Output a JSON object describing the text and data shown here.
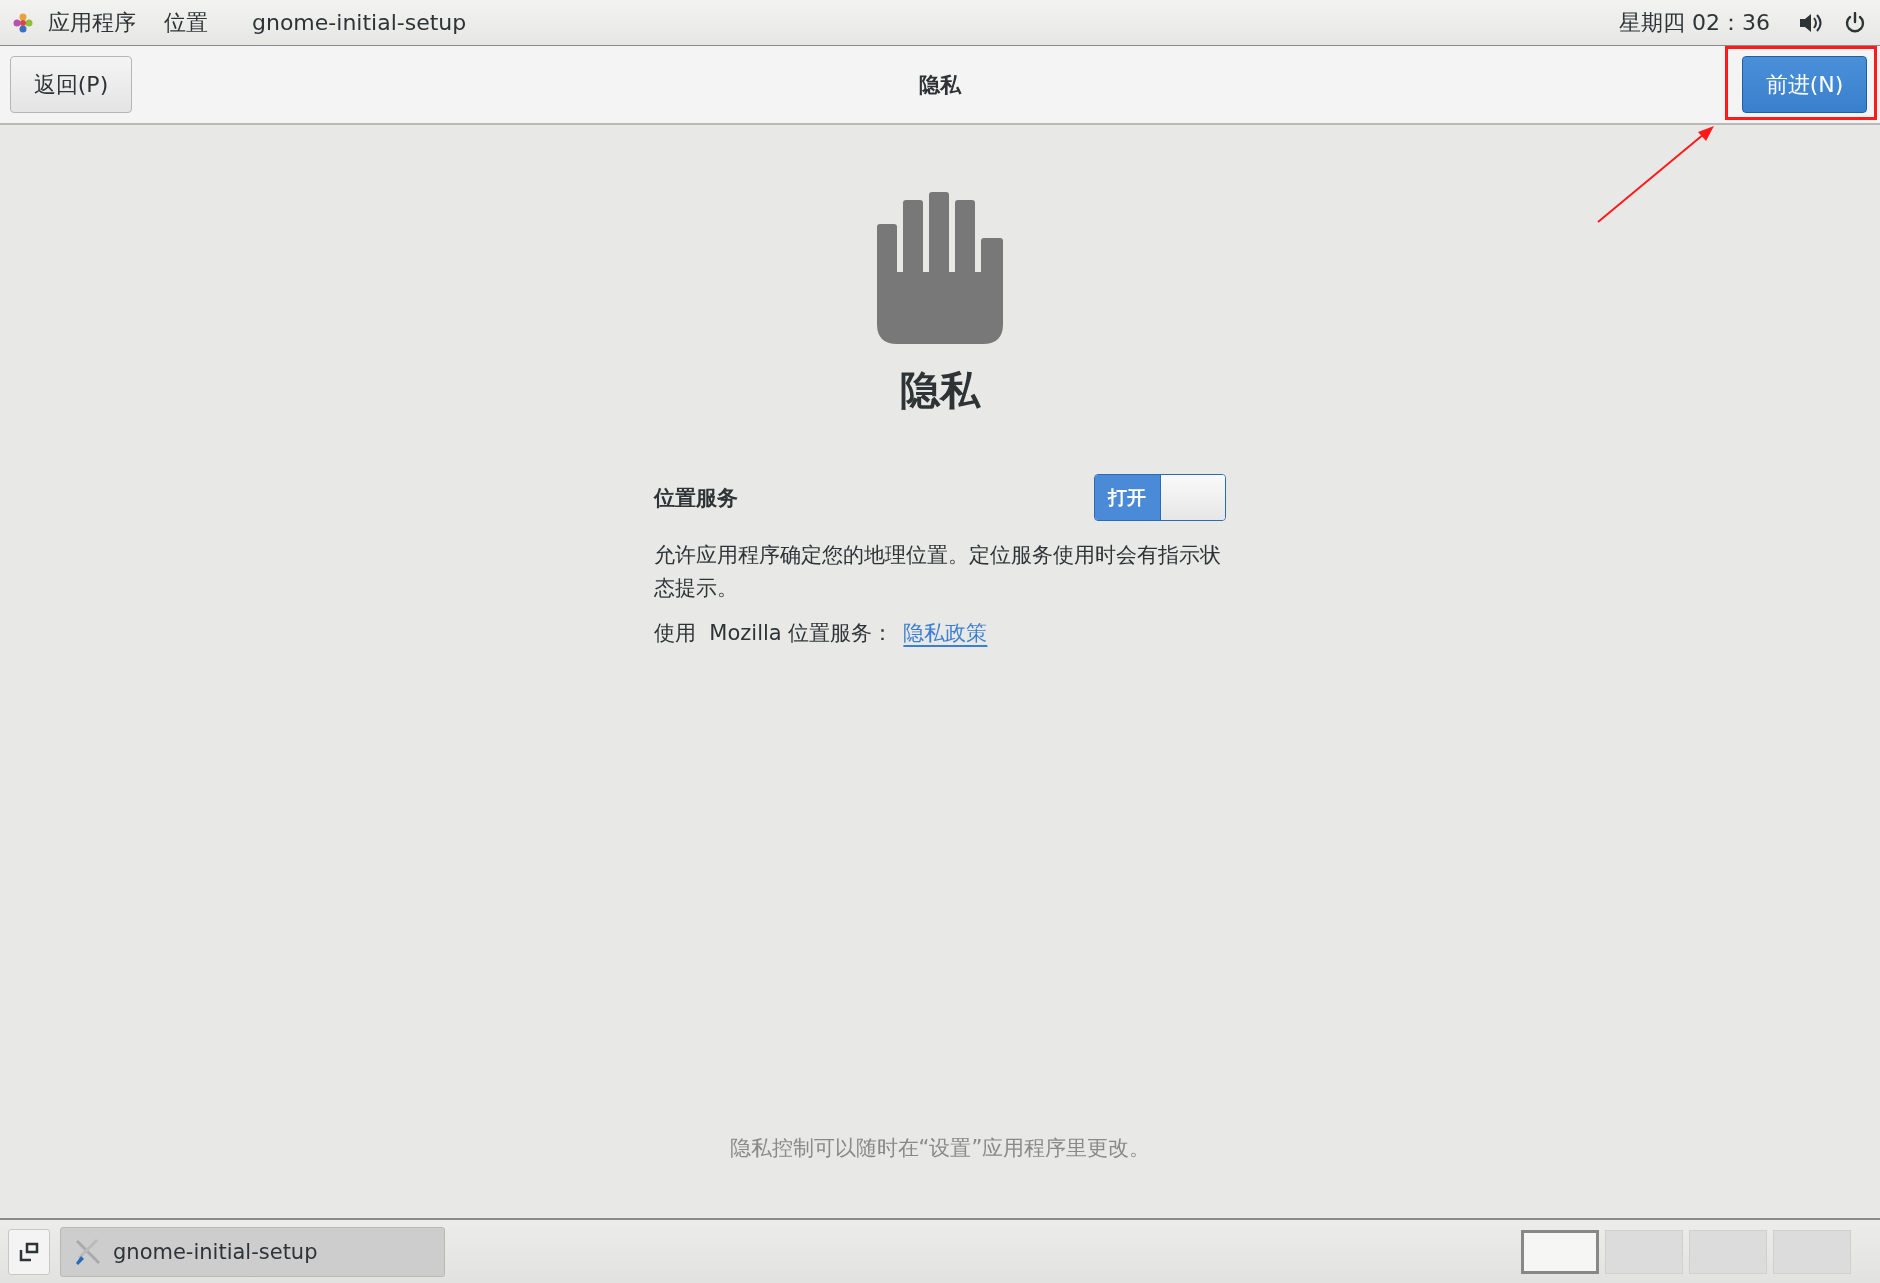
{
  "top_bar": {
    "menus": [
      {
        "label": "应用程序"
      },
      {
        "label": "位置"
      }
    ],
    "window_title": "gnome-initial-setup",
    "clock": "星期四 02：36"
  },
  "header_bar": {
    "back_button": "返回(P)",
    "title": "隐私",
    "next_button": "前进(N)",
    "next_highlighted": true
  },
  "page": {
    "heading": "隐私",
    "location_services": {
      "label": "位置服务",
      "toggle": {
        "label": "打开",
        "on": true
      }
    },
    "description": "允许应用程序确定您的地理位置。定位服务使用时会有指示状态提示。",
    "provider_text": "使用  Mozilla 位置服务：",
    "policy_link": "隐私政策",
    "footer": "隐私控制可以随时在“设置”应用程序里更改。"
  },
  "taskbar": {
    "window_button": "gnome-initial-setup",
    "workspaces": [
      {
        "selected": true
      },
      {
        "selected": false
      },
      {
        "selected": false
      },
      {
        "selected": false
      }
    ]
  }
}
